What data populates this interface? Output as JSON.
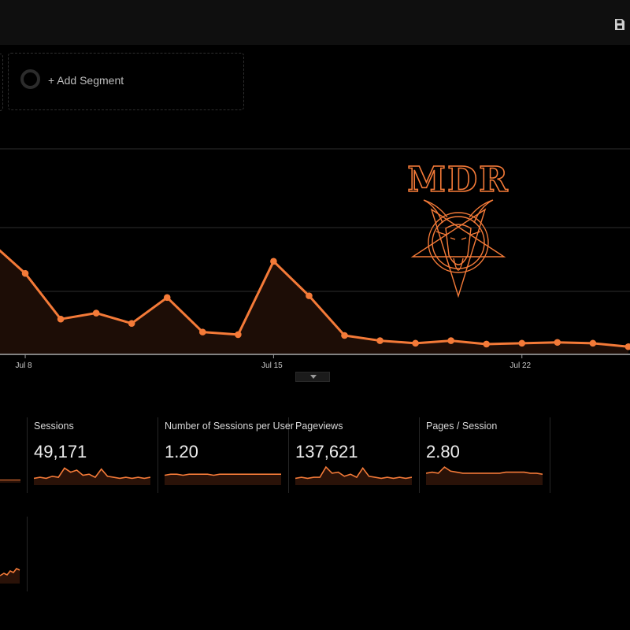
{
  "header": {
    "save_icon": "floppy-disk-icon"
  },
  "segments": {
    "add_segment_label": "+ Add Segment"
  },
  "colors": {
    "accent": "#f47a38",
    "background": "#000000",
    "area_fill": "#1d0d06",
    "grid": "#2e2e2e"
  },
  "chart_data": {
    "type": "area",
    "x_tick_labels": [
      "Jul 8",
      "Jul 15",
      "Jul 22"
    ],
    "values": [
      130,
      93,
      40,
      47,
      35,
      65,
      25,
      22,
      107,
      67,
      21,
      15,
      12,
      15,
      11,
      12,
      13,
      12,
      8
    ],
    "legend": "none",
    "grid": true
  },
  "logo": {
    "text": "MDR"
  },
  "metrics": [
    {
      "name": "Sessions",
      "value": "49,171",
      "spark": [
        2,
        3,
        2,
        4,
        3,
        12,
        8,
        10,
        5,
        6,
        3,
        11,
        4,
        3,
        2,
        3,
        2,
        3,
        2,
        3
      ]
    },
    {
      "name": "Number of Sessions per User",
      "value": "1.20",
      "spark": [
        5,
        6,
        6,
        5,
        6,
        6,
        6,
        6,
        5,
        6,
        6,
        6,
        6,
        6,
        6,
        6,
        6,
        6,
        6,
        6
      ]
    },
    {
      "name": "Pageviews",
      "value": "137,621",
      "spark": [
        2,
        3,
        2,
        3,
        3,
        13,
        7,
        8,
        4,
        6,
        3,
        12,
        4,
        3,
        2,
        3,
        2,
        3,
        2,
        3
      ]
    },
    {
      "name": "Pages / Session",
      "value": "2.80",
      "spark": [
        7,
        8,
        7,
        13,
        9,
        8,
        7,
        7,
        7,
        7,
        7,
        7,
        7,
        8,
        8,
        8,
        8,
        7,
        7,
        6
      ]
    }
  ]
}
